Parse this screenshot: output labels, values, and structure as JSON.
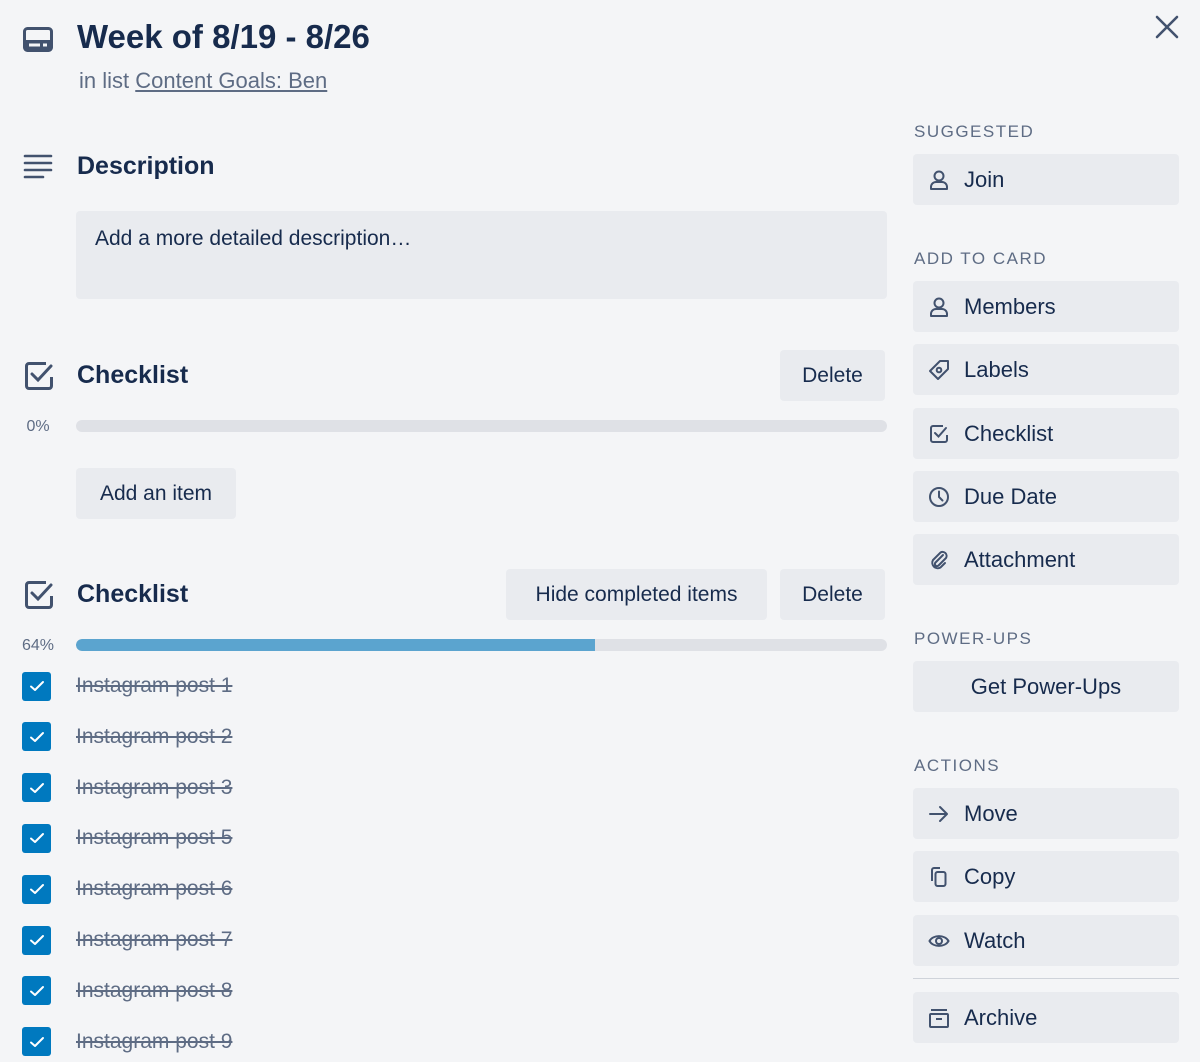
{
  "card": {
    "title": "Week of 8/19 - 8/26",
    "in_list_prefix": "in list",
    "list_name": "Content Goals: Ben"
  },
  "description": {
    "heading": "Description",
    "placeholder": "Add a more detailed description…"
  },
  "checklists": [
    {
      "heading": "Checklist",
      "progress_label": "0%",
      "progress": 0,
      "add_item_label": "Add an item",
      "delete_label": "Delete",
      "items": []
    },
    {
      "heading": "Checklist",
      "progress_label": "64%",
      "progress": 64,
      "hide_completed_label": "Hide completed items",
      "delete_label": "Delete",
      "items": [
        {
          "text": "Instagram post 1",
          "checked": true
        },
        {
          "text": "Instagram post 2",
          "checked": true
        },
        {
          "text": "Instagram post 3",
          "checked": true
        },
        {
          "text": "Instagram post 5",
          "checked": true
        },
        {
          "text": "Instagram post 6",
          "checked": true
        },
        {
          "text": "Instagram post 7",
          "checked": true
        },
        {
          "text": "Instagram post 8",
          "checked": true
        },
        {
          "text": "Instagram post 9",
          "checked": true
        }
      ]
    }
  ],
  "sidebar": {
    "suggested": {
      "heading": "SUGGESTED",
      "join": "Join"
    },
    "add_to_card": {
      "heading": "ADD TO CARD",
      "members": "Members",
      "labels": "Labels",
      "checklist": "Checklist",
      "due_date": "Due Date",
      "attachment": "Attachment"
    },
    "power_ups": {
      "heading": "POWER-UPS",
      "get": "Get Power-Ups"
    },
    "actions": {
      "heading": "ACTIONS",
      "move": "Move",
      "copy": "Copy",
      "watch": "Watch",
      "archive": "Archive"
    }
  },
  "colors": {
    "accent": "#0079bf",
    "progress_fill": "#5ba4cf",
    "text": "#172b4d",
    "muted": "#5e6c84",
    "button_bg": "#e9ebef",
    "background": "#f4f5f7"
  }
}
